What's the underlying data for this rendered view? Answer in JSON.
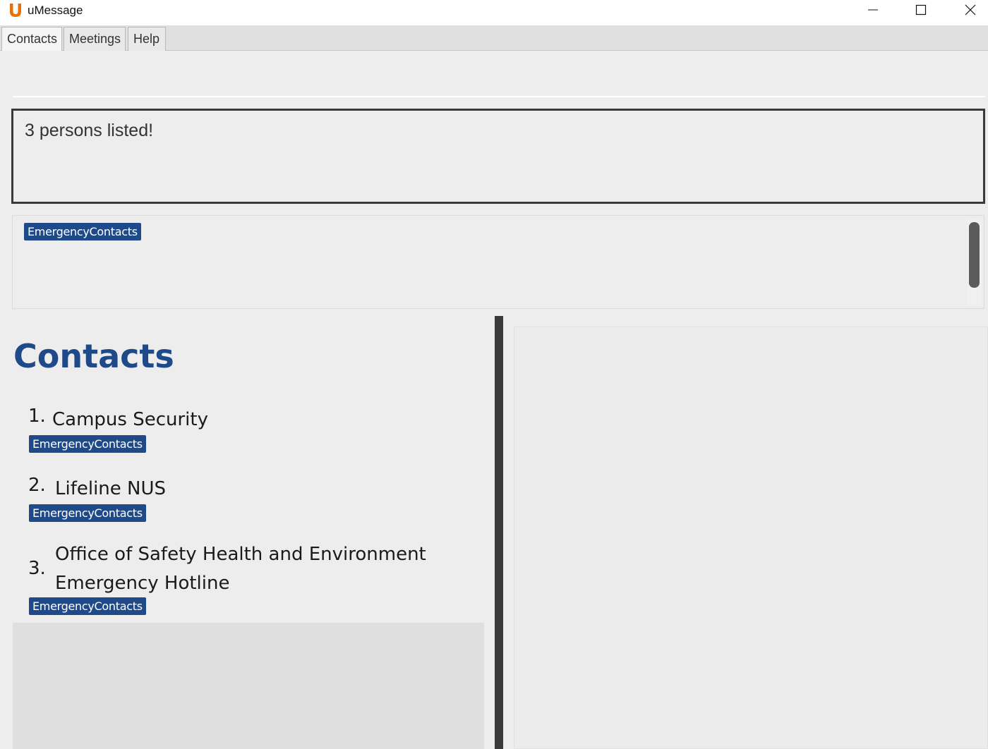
{
  "window": {
    "title": "uMessage",
    "logo_glyph": "U",
    "controls": [
      "minimize-icon",
      "maximize-icon",
      "close-icon"
    ]
  },
  "menu": {
    "tabs": [
      {
        "label": "Contacts",
        "active": true
      },
      {
        "label": "Meetings",
        "active": false
      },
      {
        "label": "Help",
        "active": false
      }
    ]
  },
  "command_box": {
    "value": ""
  },
  "result": {
    "text": "3 persons listed!"
  },
  "tags_panel": {
    "tags": [
      "EmergencyContacts"
    ]
  },
  "contacts": {
    "heading": "Contacts",
    "items": [
      {
        "index": "1.",
        "name": "Campus Security",
        "tag": "EmergencyContacts"
      },
      {
        "index": "2.",
        "name": "Lifeline NUS",
        "tag": "EmergencyContacts"
      },
      {
        "index": "3.",
        "name": "Office of Safety Health and Environment Emergency Hotline",
        "tag": "EmergencyContacts"
      }
    ]
  },
  "colors": {
    "accent": "#1f4a8a",
    "logo": "#e8710a",
    "background": "#ededed",
    "border": "#3a3a3a"
  }
}
